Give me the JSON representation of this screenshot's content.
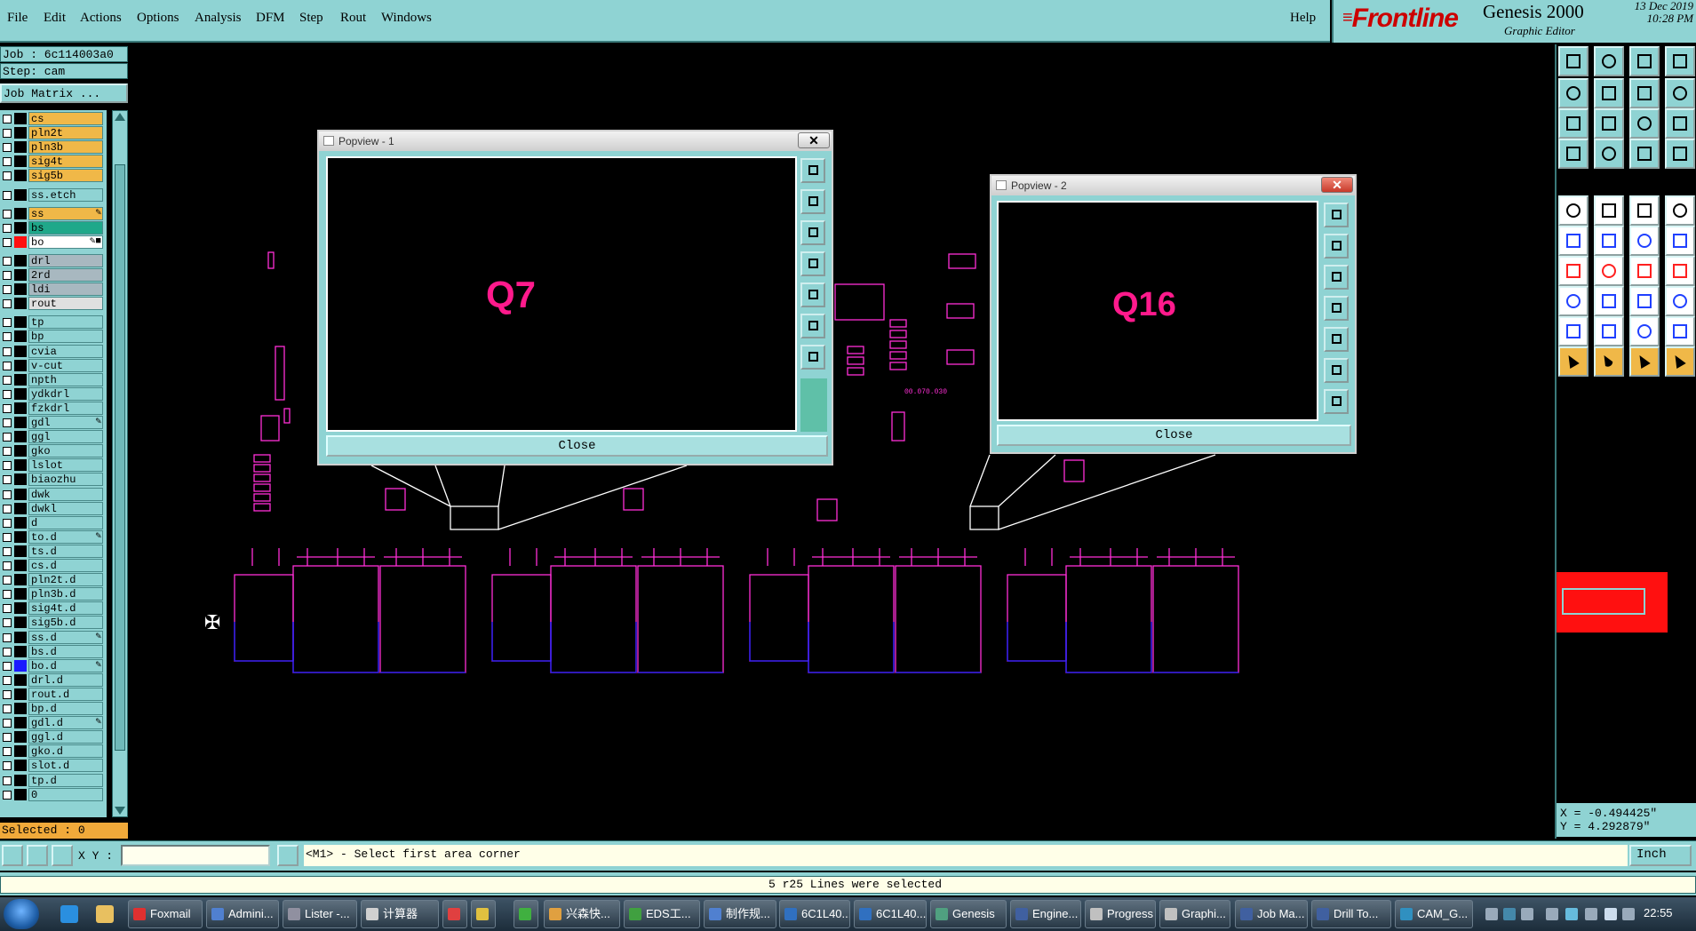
{
  "menu": [
    "File",
    "Edit",
    "Actions",
    "Options",
    "Analysis",
    "DFM",
    "Step",
    "Rout",
    "Windows"
  ],
  "menu_underline": [
    "F",
    "E",
    "A",
    "O",
    "A",
    "D",
    "S",
    "R",
    "W"
  ],
  "help": "Help",
  "brand": {
    "logo": "Frontline",
    "name": "Genesis 2000",
    "subtitle": "Graphic Editor",
    "date": "13 Dec 2019",
    "time": "10:28 PM"
  },
  "job": {
    "job_line": "Job : 6c114003a0",
    "step_line": "Step: cam",
    "matrix_button": "Job Matrix ..."
  },
  "layers": [
    {
      "name": "cs",
      "bg": "#f0b848",
      "sw": "#000000",
      "ed": ""
    },
    {
      "name": "pln2t",
      "bg": "#f0b848",
      "sw": "#000000",
      "ed": ""
    },
    {
      "name": "pln3b",
      "bg": "#f0b848",
      "sw": "#000000",
      "ed": ""
    },
    {
      "name": "sig4t",
      "bg": "#f0b848",
      "sw": "#000000",
      "ed": ""
    },
    {
      "name": "sig5b",
      "bg": "#f0b848",
      "sw": "#000000",
      "ed": ""
    },
    {
      "name": "ss.etch",
      "bg": "#8fd3d3",
      "sw": "#000000",
      "ed": ""
    },
    {
      "name": "ss",
      "bg": "#f0b848",
      "sw": "#000000",
      "ed": "✎"
    },
    {
      "name": "bs",
      "bg": "#1fa88a",
      "sw": "#000000",
      "ed": ""
    },
    {
      "name": "bo",
      "bg": "#ffffff",
      "sw": "#ff1010",
      "ed": "✎■"
    },
    {
      "name": "drl",
      "bg": "#a8b8c0",
      "sw": "#000000",
      "ed": ""
    },
    {
      "name": "2rd",
      "bg": "#a8b8c0",
      "sw": "#000000",
      "ed": ""
    },
    {
      "name": "ldi",
      "bg": "#a8b8c0",
      "sw": "#000000",
      "ed": ""
    },
    {
      "name": "rout",
      "bg": "#e0e0e0",
      "sw": "#000000",
      "ed": ""
    },
    {
      "name": "tp",
      "bg": "#8fd3d3",
      "sw": "#000000",
      "ed": ""
    },
    {
      "name": "bp",
      "bg": "#8fd3d3",
      "sw": "#000000",
      "ed": ""
    },
    {
      "name": "cvia",
      "bg": "#8fd3d3",
      "sw": "#000000",
      "ed": ""
    },
    {
      "name": "v-cut",
      "bg": "#8fd3d3",
      "sw": "#000000",
      "ed": ""
    },
    {
      "name": "npth",
      "bg": "#8fd3d3",
      "sw": "#000000",
      "ed": ""
    },
    {
      "name": "ydkdrl",
      "bg": "#8fd3d3",
      "sw": "#000000",
      "ed": ""
    },
    {
      "name": "fzkdrl",
      "bg": "#8fd3d3",
      "sw": "#000000",
      "ed": ""
    },
    {
      "name": "gdl",
      "bg": "#8fd3d3",
      "sw": "#000000",
      "ed": "✎"
    },
    {
      "name": "ggl",
      "bg": "#8fd3d3",
      "sw": "#000000",
      "ed": ""
    },
    {
      "name": "gko",
      "bg": "#8fd3d3",
      "sw": "#000000",
      "ed": ""
    },
    {
      "name": "lslot",
      "bg": "#8fd3d3",
      "sw": "#000000",
      "ed": ""
    },
    {
      "name": "biaozhu",
      "bg": "#8fd3d3",
      "sw": "#000000",
      "ed": ""
    },
    {
      "name": "dwk",
      "bg": "#8fd3d3",
      "sw": "#000000",
      "ed": ""
    },
    {
      "name": "dwkl",
      "bg": "#8fd3d3",
      "sw": "#000000",
      "ed": ""
    },
    {
      "name": "d",
      "bg": "#8fd3d3",
      "sw": "#000000",
      "ed": ""
    },
    {
      "name": "to.d",
      "bg": "#8fd3d3",
      "sw": "#000000",
      "ed": "✎"
    },
    {
      "name": "ts.d",
      "bg": "#8fd3d3",
      "sw": "#000000",
      "ed": ""
    },
    {
      "name": "cs.d",
      "bg": "#8fd3d3",
      "sw": "#000000",
      "ed": ""
    },
    {
      "name": "pln2t.d",
      "bg": "#8fd3d3",
      "sw": "#000000",
      "ed": ""
    },
    {
      "name": "pln3b.d",
      "bg": "#8fd3d3",
      "sw": "#000000",
      "ed": ""
    },
    {
      "name": "sig4t.d",
      "bg": "#8fd3d3",
      "sw": "#000000",
      "ed": ""
    },
    {
      "name": "sig5b.d",
      "bg": "#8fd3d3",
      "sw": "#000000",
      "ed": ""
    },
    {
      "name": "ss.d",
      "bg": "#8fd3d3",
      "sw": "#000000",
      "ed": "✎"
    },
    {
      "name": "bs.d",
      "bg": "#8fd3d3",
      "sw": "#000000",
      "ed": ""
    },
    {
      "name": "bo.d",
      "bg": "#8fd3d3",
      "sw": "#1a1aff",
      "ed": "✎"
    },
    {
      "name": "drl.d",
      "bg": "#8fd3d3",
      "sw": "#000000",
      "ed": ""
    },
    {
      "name": "rout.d",
      "bg": "#8fd3d3",
      "sw": "#000000",
      "ed": ""
    },
    {
      "name": "bp.d",
      "bg": "#8fd3d3",
      "sw": "#000000",
      "ed": ""
    },
    {
      "name": "gdl.d",
      "bg": "#8fd3d3",
      "sw": "#000000",
      "ed": "✎"
    },
    {
      "name": "ggl.d",
      "bg": "#8fd3d3",
      "sw": "#000000",
      "ed": ""
    },
    {
      "name": "gko.d",
      "bg": "#8fd3d3",
      "sw": "#000000",
      "ed": ""
    },
    {
      "name": "slot.d",
      "bg": "#8fd3d3",
      "sw": "#000000",
      "ed": ""
    },
    {
      "name": "tp.d",
      "bg": "#8fd3d3",
      "sw": "#000000",
      "ed": ""
    },
    {
      "name": "0",
      "bg": "#8fd3d3",
      "sw": "#000000",
      "ed": ""
    }
  ],
  "selected": "Selected : 0",
  "popview1": {
    "title": "Popview - 1",
    "label": "Q7",
    "close": "Close"
  },
  "popview2": {
    "title": "Popview - 2",
    "label": "Q16",
    "close": "Close"
  },
  "canvas_text": "00.070.030",
  "coords": {
    "x": "X = -0.494425\"",
    "y": "Y = 4.292879\""
  },
  "cmd": {
    "xy_label": "X Y :",
    "xy_value": "",
    "prompt": "<M1> - Select first area corner",
    "units": "Inch"
  },
  "status": "5 r25 Lines were selected",
  "colors": {
    "panel": "#8fd3d3",
    "magenta": "#ff2fd6",
    "blue": "#2020ff",
    "label_pink": "#ff1a8c",
    "menu_bg": "#8fd3d3"
  },
  "taskbar": {
    "items": [
      "Foxmail",
      "Admini...",
      "Lister -...",
      "计算器",
      "",
      "",
      "",
      "兴森快...",
      "EDS工...",
      "制作规...",
      "6C1L40...",
      "6C1L40...",
      "Genesis",
      "Engine...",
      "Progress",
      "Graphi...",
      "Job Ma...",
      "Drill To...",
      "CAM_G..."
    ],
    "clock": "22:55"
  }
}
